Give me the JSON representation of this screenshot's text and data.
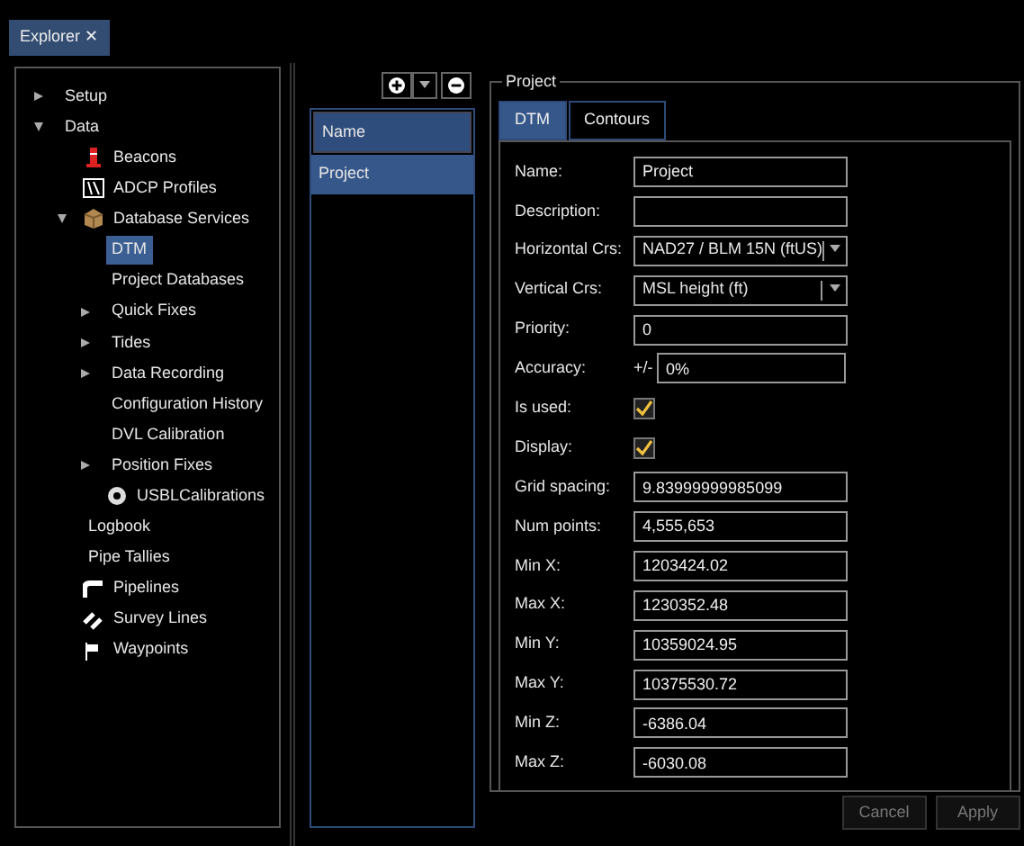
{
  "window_tab": {
    "title": "Explorer",
    "close": "✕"
  },
  "tree": [
    {
      "label": "Setup",
      "expanded": false
    },
    {
      "label": "Data",
      "expanded": true,
      "children": [
        {
          "label": "Beacons",
          "kind": "beacon"
        },
        {
          "label": "ADCP Profiles",
          "kind": "profile"
        },
        {
          "label": "Database Services",
          "kind": "box",
          "expanded": true,
          "children": [
            {
              "label": "DTM",
              "selected": true
            },
            {
              "label": "Project Databases",
              "selected": false
            },
            {
              "label": "Quick Fixes",
              "expanded": false
            },
            {
              "label": "Tides",
              "expanded": false
            },
            {
              "label": "Data Recording",
              "expanded": false
            },
            {
              "label": "Configuration History",
              "selected": false
            },
            {
              "label": "DVL Calibration",
              "selected": false
            },
            {
              "label": "Position Fixes",
              "expanded": false
            },
            {
              "label": "USBLCalibrations",
              "kind": "gear"
            }
          ]
        },
        {
          "label": "Logbook"
        },
        {
          "label": "Pipe Tallies"
        },
        {
          "label": "Pipelines",
          "kind": "pipe"
        },
        {
          "label": "Survey Lines",
          "kind": "lines"
        },
        {
          "label": "Waypoints",
          "kind": "flag"
        }
      ]
    }
  ],
  "list": {
    "header": "Name",
    "rows": [
      {
        "label": "Project",
        "selected": true
      }
    ]
  },
  "group": {
    "title": "Project",
    "tabs": [
      {
        "label": "DTM",
        "selected": true
      },
      {
        "label": "Contours",
        "selected": false
      }
    ],
    "fields": [
      {
        "kind": "text",
        "label": "Name:",
        "value": "Project"
      },
      {
        "kind": "text",
        "label": "Description:"
      },
      {
        "kind": "combo",
        "label": "Horizontal Crs:",
        "value": "NAD27 / BLM 15N (ftUS)"
      },
      {
        "kind": "combo",
        "label": "Vertical Crs:",
        "value": "MSL height (ft)"
      },
      {
        "kind": "text",
        "label": "Priority:",
        "value": "0"
      },
      {
        "kind": "accuracy",
        "label": "Accuracy:",
        "prefix": "+/-",
        "value": "0%"
      },
      {
        "kind": "check",
        "label": "Is used:",
        "checked": true
      },
      {
        "kind": "check",
        "label": "Display:",
        "checked": true
      },
      {
        "kind": "text",
        "label": "Grid spacing:",
        "value": "9.83999999985099"
      },
      {
        "kind": "text",
        "label": "Num points:",
        "value": "4,555,653"
      },
      {
        "kind": "text",
        "label": "Min X:",
        "value": "1203424.02"
      },
      {
        "kind": "text",
        "label": "Max X:",
        "value": "1230352.48"
      },
      {
        "kind": "text",
        "label": "Min Y:",
        "value": "10359024.95"
      },
      {
        "kind": "text",
        "label": "Max Y:",
        "value": "10375530.72"
      },
      {
        "kind": "text",
        "label": "Min Z:",
        "value": "-6386.04"
      },
      {
        "kind": "text",
        "label": "Max Z:",
        "value": "-6030.08"
      }
    ]
  },
  "buttons": [
    {
      "label": "Cancel",
      "disabled": true
    },
    {
      "label": "Apply",
      "disabled": true
    }
  ]
}
